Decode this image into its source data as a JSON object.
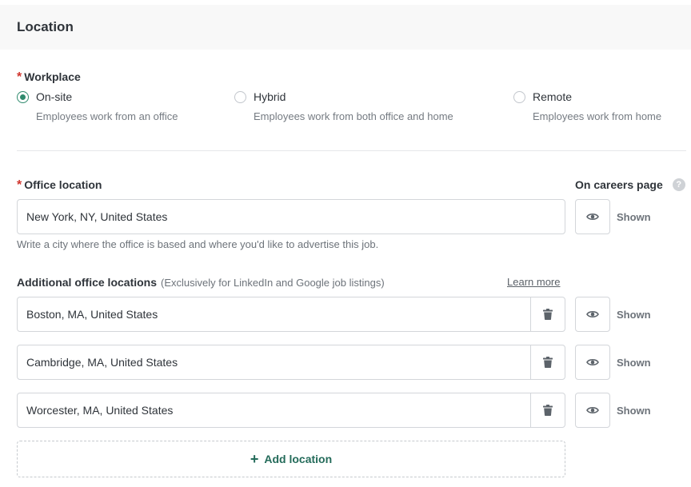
{
  "section": {
    "title": "Location"
  },
  "workplace": {
    "label": "Workplace",
    "required_mark": "*",
    "selected": "On-site",
    "options": [
      {
        "label": "On-site",
        "description": "Employees work from an office",
        "checked": true
      },
      {
        "label": "Hybrid",
        "description": "Employees work from both office and home",
        "checked": false
      },
      {
        "label": "Remote",
        "description": "Employees work from home",
        "checked": false
      }
    ]
  },
  "office": {
    "label": "Office location",
    "required_mark": "*",
    "value": "New York, NY, United States",
    "hint": "Write a city where the office is based and where you'd like to advertise this job.",
    "visibility": "Shown"
  },
  "careers": {
    "label": "On careers page",
    "help_icon": "question-circle-icon"
  },
  "additional": {
    "label": "Additional office locations",
    "note": "(Exclusively for LinkedIn and Google job listings)",
    "learn_more": "Learn more",
    "locations": [
      {
        "value": "Boston, MA, United States",
        "visibility": "Shown"
      },
      {
        "value": "Cambridge, MA, United States",
        "visibility": "Shown"
      },
      {
        "value": "Worcester, MA, United States",
        "visibility": "Shown"
      }
    ],
    "add_label": "Add location"
  },
  "colors": {
    "accent": "#2f8a6d",
    "link": "#246b5a",
    "required": "#d0342c",
    "header_bg": "#f8f8f8"
  },
  "icons": {
    "radio": "radio-icon",
    "trash": "trash-icon",
    "eye": "eye-icon",
    "plus": "plus-icon",
    "help": "question-circle-icon"
  }
}
